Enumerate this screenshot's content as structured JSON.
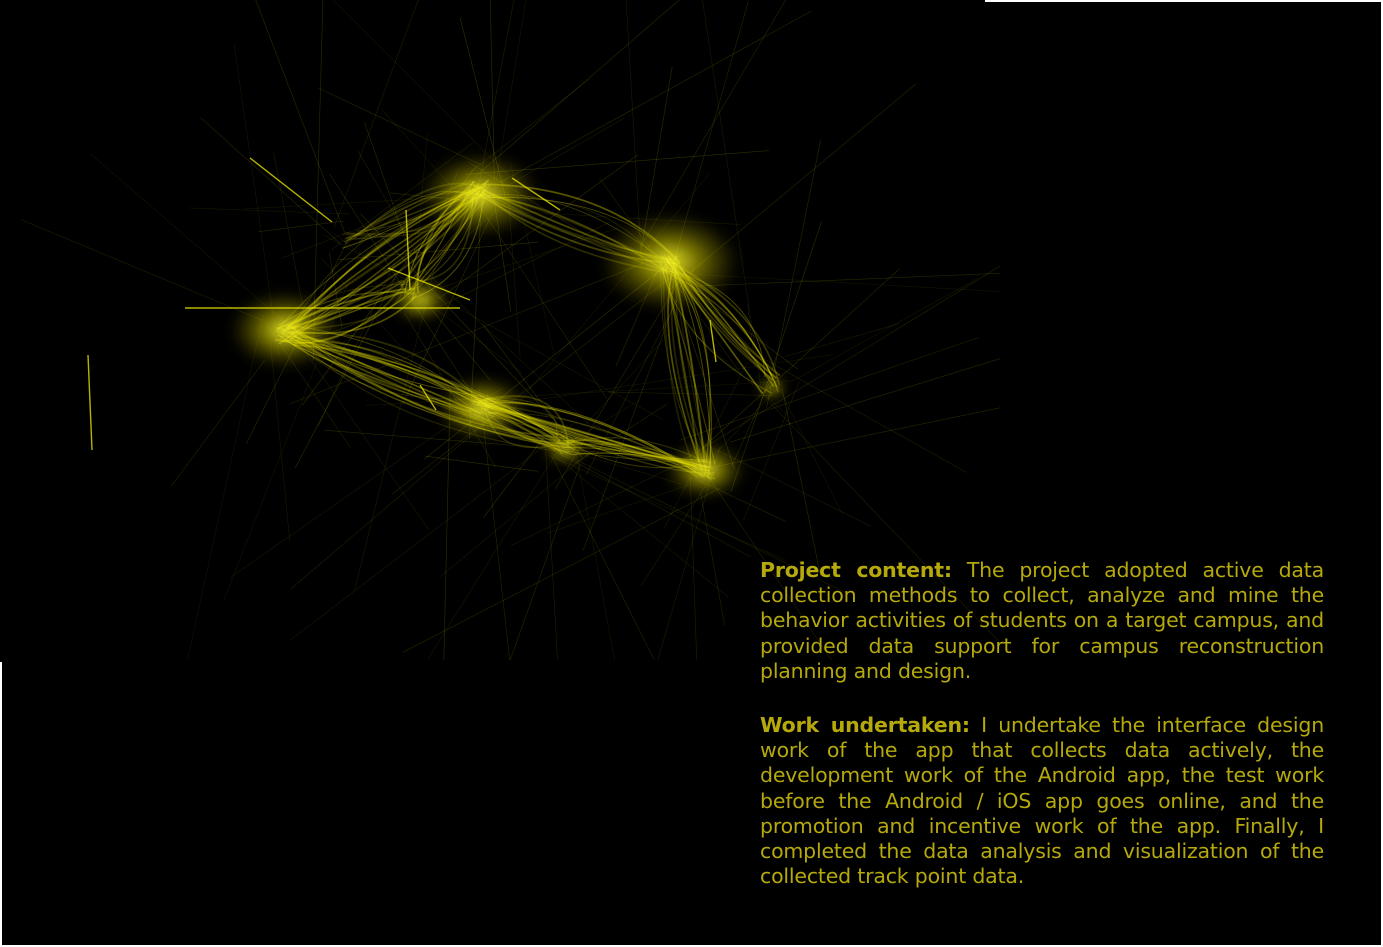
{
  "project_content": {
    "label": "Project content:",
    "text": "The project adopted active data collection methods to collect, analyze and mine the behavior activities of students on a target campus, and provided data support for campus reconstruction planning and design."
  },
  "work_undertaken": {
    "label": "Work undertaken:",
    "text": "I undertake the interface design work of the app that collects data actively, the development work of the Android app, the test work before the Android / iOS app goes online, and the promotion and incentive work of the app. Finally, I completed the data analysis and visualization of the collected track point data."
  },
  "colors": {
    "background": "#000000",
    "trace": "#f5f000",
    "text": "#b5a90c"
  },
  "image": {
    "subject": "glowing yellow track-point trajectory visualization on black background"
  }
}
